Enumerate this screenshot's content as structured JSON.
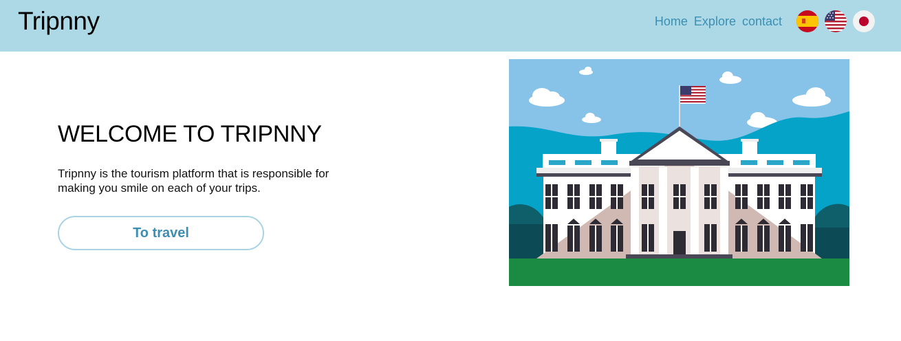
{
  "navbar": {
    "brand": "Tripnny",
    "links": [
      "Home",
      "Explore",
      "contact"
    ],
    "languages": [
      {
        "icon": "spain-flag-icon",
        "colors": [
          "#c60b1e",
          "#ffc400"
        ]
      },
      {
        "icon": "usa-flag-icon",
        "colors": [
          "#b22234",
          "#ffffff",
          "#3c3b6e"
        ]
      },
      {
        "icon": "japan-flag-icon",
        "colors": [
          "#ffffff",
          "#bc002d"
        ]
      }
    ],
    "background": "#add8e6",
    "link_color": "#3b8fb3"
  },
  "hero": {
    "title": "WELCOME TO TRIPNNY",
    "description": "Tripnny is the tourism platform that is responsible for making you smile on each of your trips.",
    "button_label": "To travel",
    "illustration": "white-house-illustration"
  }
}
